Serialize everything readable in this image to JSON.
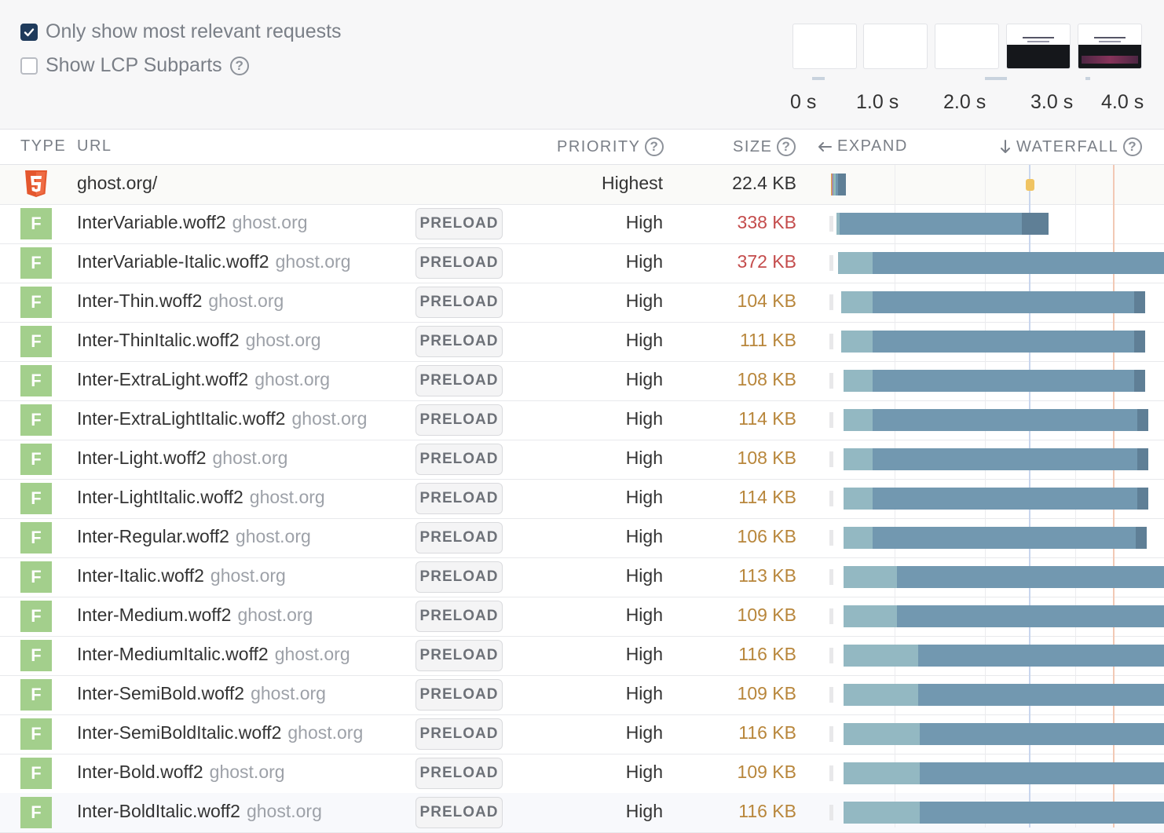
{
  "options": {
    "relevant_label": "Only show most relevant requests",
    "relevant_checked": true,
    "lcp_label": "Show LCP Subparts",
    "lcp_checked": false
  },
  "filmstrip": {
    "ticks": [
      "0 s",
      "1.0 s",
      "2.0 s",
      "3.0 s",
      "4.0 s"
    ]
  },
  "headers": {
    "type": "TYPE",
    "url": "URL",
    "priority": "PRIORITY",
    "size": "SIZE",
    "expand": "EXPAND",
    "waterfall": "WATERFALL"
  },
  "colors": {
    "font_badge": "#a3cf8c",
    "size_red": "#c44c4c",
    "size_orange": "#b8863b",
    "wait": "#93b8c2",
    "download": "#7298b0",
    "receive": "#5f7f96",
    "lcp_line": "#c9d6ee",
    "load_line": "#f2c9b5"
  },
  "requests": [
    {
      "type": "html",
      "url": "ghost.org/",
      "domain": "",
      "tag": "",
      "priority": "Highest",
      "size": "22.4 KB",
      "size_class": "normal",
      "bar": {
        "start": 0.0,
        "wait": 0.05,
        "dl": 0.12
      }
    },
    {
      "type": "F",
      "url": "InterVariable.woff2",
      "domain": "ghost.org",
      "tag": "PRELOAD",
      "priority": "High",
      "size": "338 KB",
      "size_class": "red",
      "bar": {
        "start": 0.06,
        "wait": 0.04,
        "dl": 2.4
      }
    },
    {
      "type": "F",
      "url": "InterVariable-Italic.woff2",
      "domain": "ghost.org",
      "tag": "PRELOAD",
      "priority": "High",
      "size": "372 KB",
      "size_class": "red",
      "bar": {
        "start": 0.08,
        "wait": 0.4,
        "dl": 4.0
      }
    },
    {
      "type": "F",
      "url": "Inter-Thin.woff2",
      "domain": "ghost.org",
      "tag": "PRELOAD",
      "priority": "High",
      "size": "104 KB",
      "size_class": "orange",
      "bar": {
        "start": 0.12,
        "wait": 0.36,
        "dl": 3.12
      }
    },
    {
      "type": "F",
      "url": "Inter-ThinItalic.woff2",
      "domain": "ghost.org",
      "tag": "PRELOAD",
      "priority": "High",
      "size": "111 KB",
      "size_class": "orange",
      "bar": {
        "start": 0.12,
        "wait": 0.36,
        "dl": 3.12
      }
    },
    {
      "type": "F",
      "url": "Inter-ExtraLight.woff2",
      "domain": "ghost.org",
      "tag": "PRELOAD",
      "priority": "High",
      "size": "108 KB",
      "size_class": "orange",
      "bar": {
        "start": 0.14,
        "wait": 0.34,
        "dl": 3.12
      }
    },
    {
      "type": "F",
      "url": "Inter-ExtraLightItalic.woff2",
      "domain": "ghost.org",
      "tag": "PRELOAD",
      "priority": "High",
      "size": "114 KB",
      "size_class": "orange",
      "bar": {
        "start": 0.14,
        "wait": 0.34,
        "dl": 3.16
      }
    },
    {
      "type": "F",
      "url": "Inter-Light.woff2",
      "domain": "ghost.org",
      "tag": "PRELOAD",
      "priority": "High",
      "size": "108 KB",
      "size_class": "orange",
      "bar": {
        "start": 0.14,
        "wait": 0.34,
        "dl": 3.16
      }
    },
    {
      "type": "F",
      "url": "Inter-LightItalic.woff2",
      "domain": "ghost.org",
      "tag": "PRELOAD",
      "priority": "High",
      "size": "114 KB",
      "size_class": "orange",
      "bar": {
        "start": 0.14,
        "wait": 0.34,
        "dl": 3.16
      }
    },
    {
      "type": "F",
      "url": "Inter-Regular.woff2",
      "domain": "ghost.org",
      "tag": "PRELOAD",
      "priority": "High",
      "size": "106 KB",
      "size_class": "orange",
      "bar": {
        "start": 0.14,
        "wait": 0.34,
        "dl": 3.14
      }
    },
    {
      "type": "F",
      "url": "Inter-Italic.woff2",
      "domain": "ghost.org",
      "tag": "PRELOAD",
      "priority": "High",
      "size": "113 KB",
      "size_class": "orange",
      "bar": {
        "start": 0.14,
        "wait": 0.62,
        "dl": 4.0
      }
    },
    {
      "type": "F",
      "url": "Inter-Medium.woff2",
      "domain": "ghost.org",
      "tag": "PRELOAD",
      "priority": "High",
      "size": "109 KB",
      "size_class": "orange",
      "bar": {
        "start": 0.14,
        "wait": 0.62,
        "dl": 4.0
      }
    },
    {
      "type": "F",
      "url": "Inter-MediumItalic.woff2",
      "domain": "ghost.org",
      "tag": "PRELOAD",
      "priority": "High",
      "size": "116 KB",
      "size_class": "orange",
      "bar": {
        "start": 0.14,
        "wait": 0.86,
        "dl": 4.0
      }
    },
    {
      "type": "F",
      "url": "Inter-SemiBold.woff2",
      "domain": "ghost.org",
      "tag": "PRELOAD",
      "priority": "High",
      "size": "109 KB",
      "size_class": "orange",
      "bar": {
        "start": 0.14,
        "wait": 0.86,
        "dl": 4.0
      }
    },
    {
      "type": "F",
      "url": "Inter-SemiBoldItalic.woff2",
      "domain": "ghost.org",
      "tag": "PRELOAD",
      "priority": "High",
      "size": "116 KB",
      "size_class": "orange",
      "bar": {
        "start": 0.14,
        "wait": 0.88,
        "dl": 4.0
      }
    },
    {
      "type": "F",
      "url": "Inter-Bold.woff2",
      "domain": "ghost.org",
      "tag": "PRELOAD",
      "priority": "High",
      "size": "109 KB",
      "size_class": "orange",
      "bar": {
        "start": 0.14,
        "wait": 0.88,
        "dl": 4.0
      }
    },
    {
      "type": "F",
      "url": "Inter-BoldItalic.woff2",
      "domain": "ghost.org",
      "tag": "PRELOAD",
      "priority": "High",
      "size": "116 KB",
      "size_class": "orange",
      "bar": {
        "start": 0.14,
        "wait": 0.88,
        "dl": 4.0
      }
    }
  ]
}
